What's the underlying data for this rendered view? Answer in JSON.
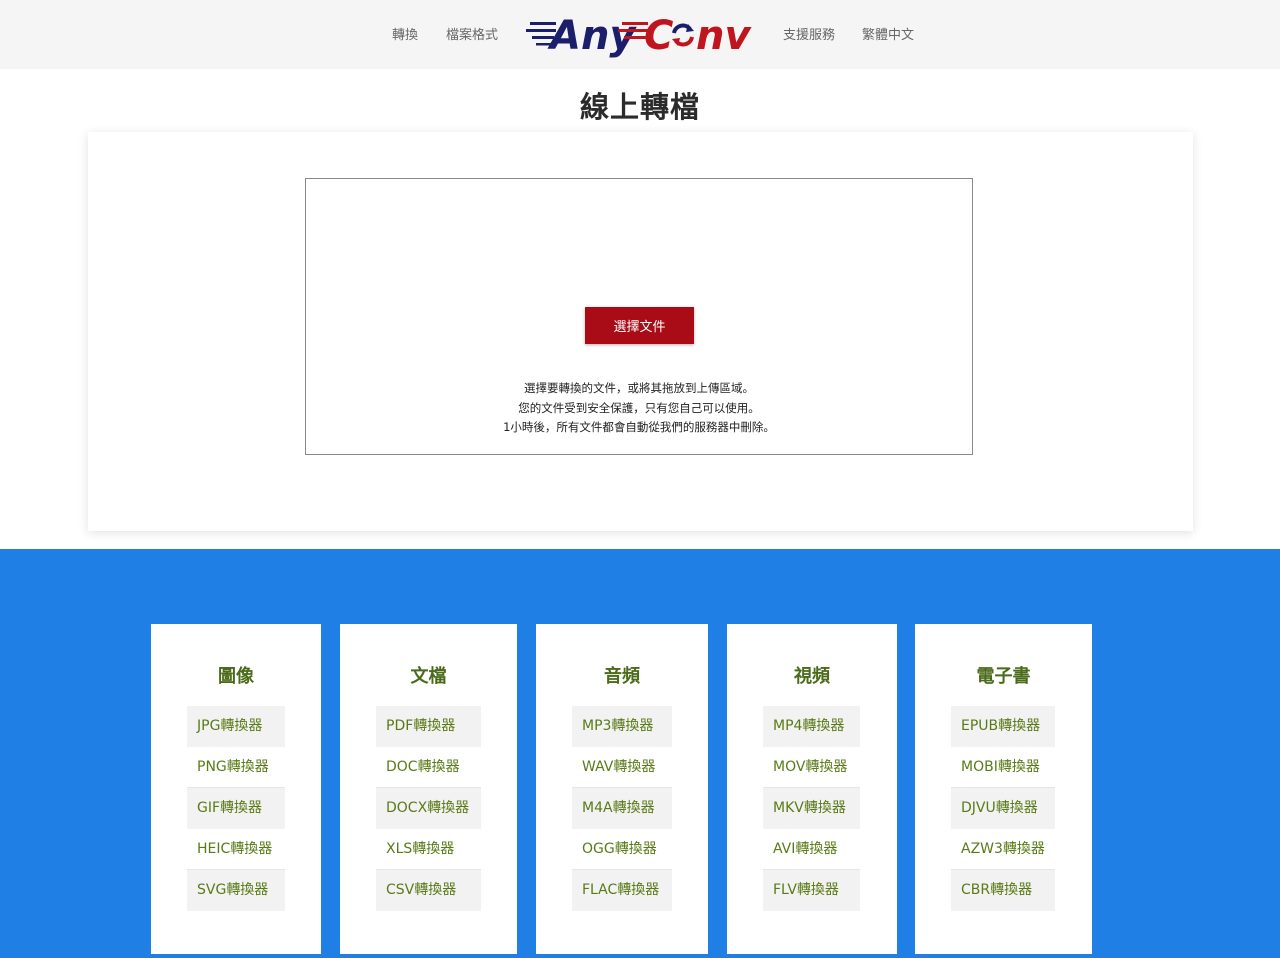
{
  "nav": {
    "convert": "轉換",
    "formats": "檔案格式",
    "support": "支援服務",
    "language": "繁體中文",
    "logo_text": "AnyConv"
  },
  "page_title": "線上轉檔",
  "upload": {
    "button_label": "選擇文件",
    "hint_line1": "選擇要轉換的文件，或將其拖放到上傳區域。",
    "hint_line2": "您的文件受到安全保護，只有您自己可以使用。",
    "hint_line3": "1小時後，所有文件都會自動從我們的服務器中刪除。"
  },
  "colors": {
    "accent_red": "#a90c17",
    "section_blue": "#1f7fe5",
    "link_green": "#5a7a16",
    "logo_navy": "#1b1f6b"
  },
  "categories": [
    {
      "title": "圖像",
      "links": [
        "JPG轉換器",
        "PNG轉換器",
        "GIF轉換器",
        "HEIC轉換器",
        "SVG轉換器"
      ]
    },
    {
      "title": "文檔",
      "links": [
        "PDF轉換器",
        "DOC轉換器",
        "DOCX轉換器",
        "XLS轉換器",
        "CSV轉換器"
      ]
    },
    {
      "title": "音頻",
      "links": [
        "MP3轉換器",
        "WAV轉換器",
        "M4A轉換器",
        "OGG轉換器",
        "FLAC轉換器"
      ]
    },
    {
      "title": "視頻",
      "links": [
        "MP4轉換器",
        "MOV轉換器",
        "MKV轉換器",
        "AVI轉換器",
        "FLV轉換器"
      ]
    },
    {
      "title": "電子書",
      "links": [
        "EPUB轉換器",
        "MOBI轉換器",
        "DJVU轉換器",
        "AZW3轉換器",
        "CBR轉換器"
      ]
    }
  ]
}
